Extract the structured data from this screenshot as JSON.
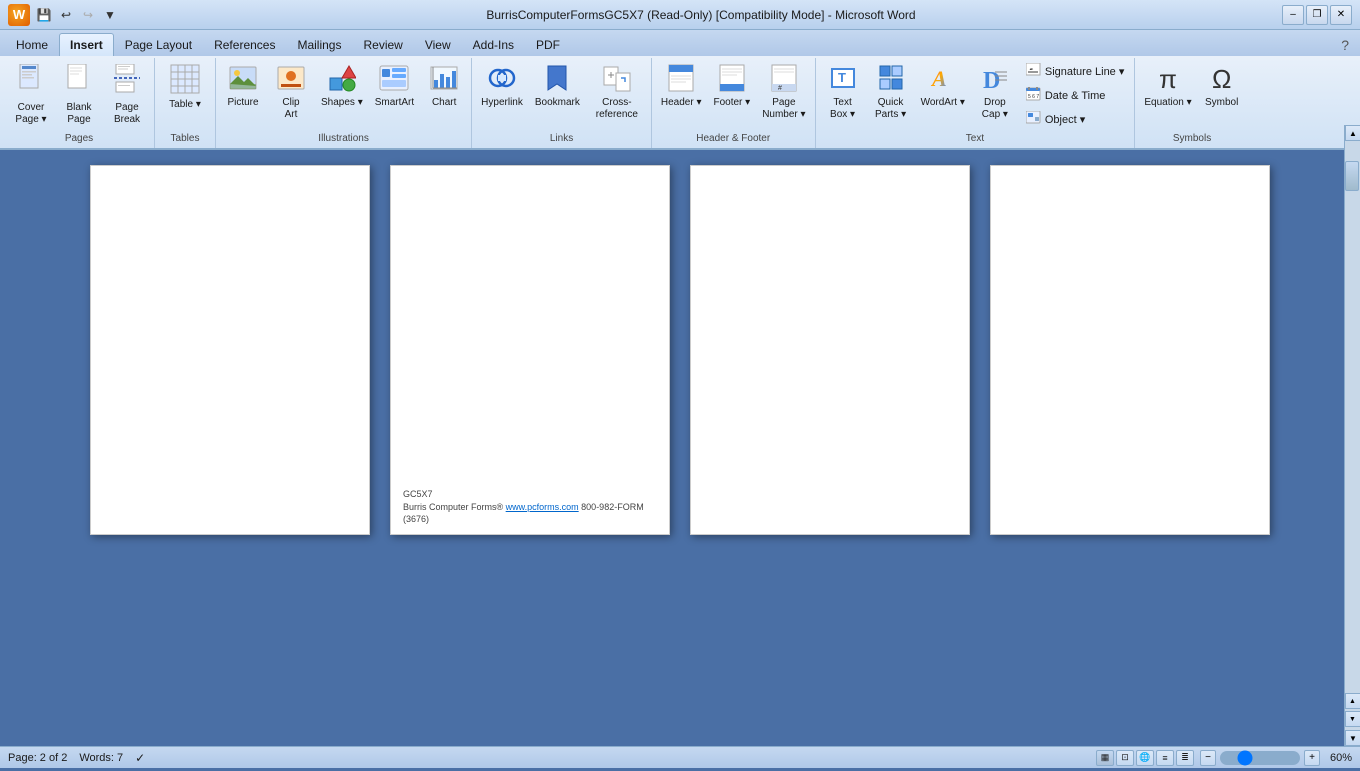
{
  "titleBar": {
    "title": "BurrisComputerFormsGC5X7 (Read-Only) [Compatibility Mode] - Microsoft Word",
    "minBtn": "–",
    "restoreBtn": "❐",
    "closeBtn": "✕"
  },
  "tabs": [
    {
      "id": "home",
      "label": "Home"
    },
    {
      "id": "insert",
      "label": "Insert",
      "active": true
    },
    {
      "id": "pagelayout",
      "label": "Page Layout"
    },
    {
      "id": "references",
      "label": "References"
    },
    {
      "id": "mailings",
      "label": "Mailings"
    },
    {
      "id": "review",
      "label": "Review"
    },
    {
      "id": "view",
      "label": "View"
    },
    {
      "id": "addins",
      "label": "Add-Ins"
    },
    {
      "id": "pdf",
      "label": "PDF"
    }
  ],
  "ribbon": {
    "groups": [
      {
        "id": "pages",
        "label": "Pages",
        "items": [
          {
            "id": "cover-page",
            "label": "Cover\nPage",
            "icon": "📄",
            "hasDropdown": true
          },
          {
            "id": "blank-page",
            "label": "Blank\nPage",
            "icon": "📋"
          },
          {
            "id": "page-break",
            "label": "Page\nBreak",
            "icon": "📃"
          }
        ]
      },
      {
        "id": "tables",
        "label": "Tables",
        "items": [
          {
            "id": "table",
            "label": "Table",
            "icon": "▦",
            "hasDropdown": true
          }
        ]
      },
      {
        "id": "illustrations",
        "label": "Illustrations",
        "items": [
          {
            "id": "picture",
            "label": "Picture",
            "icon": "🖼"
          },
          {
            "id": "clip-art",
            "label": "Clip\nArt",
            "icon": "✂"
          },
          {
            "id": "shapes",
            "label": "Shapes",
            "icon": "△",
            "hasDropdown": true
          },
          {
            "id": "smartart",
            "label": "SmartArt",
            "icon": "🔷"
          },
          {
            "id": "chart",
            "label": "Chart",
            "icon": "📊"
          }
        ]
      },
      {
        "id": "links",
        "label": "Links",
        "items": [
          {
            "id": "hyperlink",
            "label": "Hyperlink",
            "icon": "🔗"
          },
          {
            "id": "bookmark",
            "label": "Bookmark",
            "icon": "🔖"
          },
          {
            "id": "cross-reference",
            "label": "Cross-reference",
            "icon": "↗"
          }
        ]
      },
      {
        "id": "header-footer",
        "label": "Header & Footer",
        "items": [
          {
            "id": "header",
            "label": "Header",
            "icon": "⬆",
            "hasDropdown": true
          },
          {
            "id": "footer",
            "label": "Footer",
            "icon": "⬇",
            "hasDropdown": true
          },
          {
            "id": "page-number",
            "label": "Page\nNumber",
            "icon": "#",
            "hasDropdown": true
          }
        ]
      },
      {
        "id": "text",
        "label": "Text",
        "items": [
          {
            "id": "text-box",
            "label": "Text\nBox",
            "icon": "T",
            "hasDropdown": true
          },
          {
            "id": "quick-parts",
            "label": "Quick\nParts",
            "icon": "⊞",
            "hasDropdown": true
          },
          {
            "id": "wordart",
            "label": "WordArt",
            "icon": "A",
            "hasDropdown": true
          },
          {
            "id": "drop-cap",
            "label": "Drop\nCap",
            "icon": "D",
            "hasDropdown": true
          },
          {
            "id": "signature-line",
            "label": "Signature Line",
            "icon": "✒",
            "small": true,
            "hasDropdown": true
          },
          {
            "id": "date-time",
            "label": "Date & Time",
            "icon": "📅",
            "small": true
          },
          {
            "id": "object",
            "label": "Object",
            "icon": "⬜",
            "small": true,
            "hasDropdown": true
          }
        ]
      },
      {
        "id": "symbols",
        "label": "Symbols",
        "items": [
          {
            "id": "equation",
            "label": "Equation",
            "icon": "π"
          },
          {
            "id": "symbol",
            "label": "Symbol",
            "icon": "Ω"
          }
        ]
      }
    ]
  },
  "pages": [
    {
      "id": "page1",
      "hasContent": false,
      "footer": null
    },
    {
      "id": "page2",
      "hasContent": true,
      "footer": {
        "line1": "GC5X7",
        "line2": "Burris Computer Forms® www.pcforms.com 800-982-FORM (3676)"
      }
    },
    {
      "id": "page3",
      "hasContent": false,
      "footer": null
    },
    {
      "id": "page4",
      "hasContent": false,
      "footer": null
    }
  ],
  "statusBar": {
    "pageInfo": "Page: 2 of 2",
    "wordCount": "Words: 7",
    "zoomLevel": "60%"
  }
}
